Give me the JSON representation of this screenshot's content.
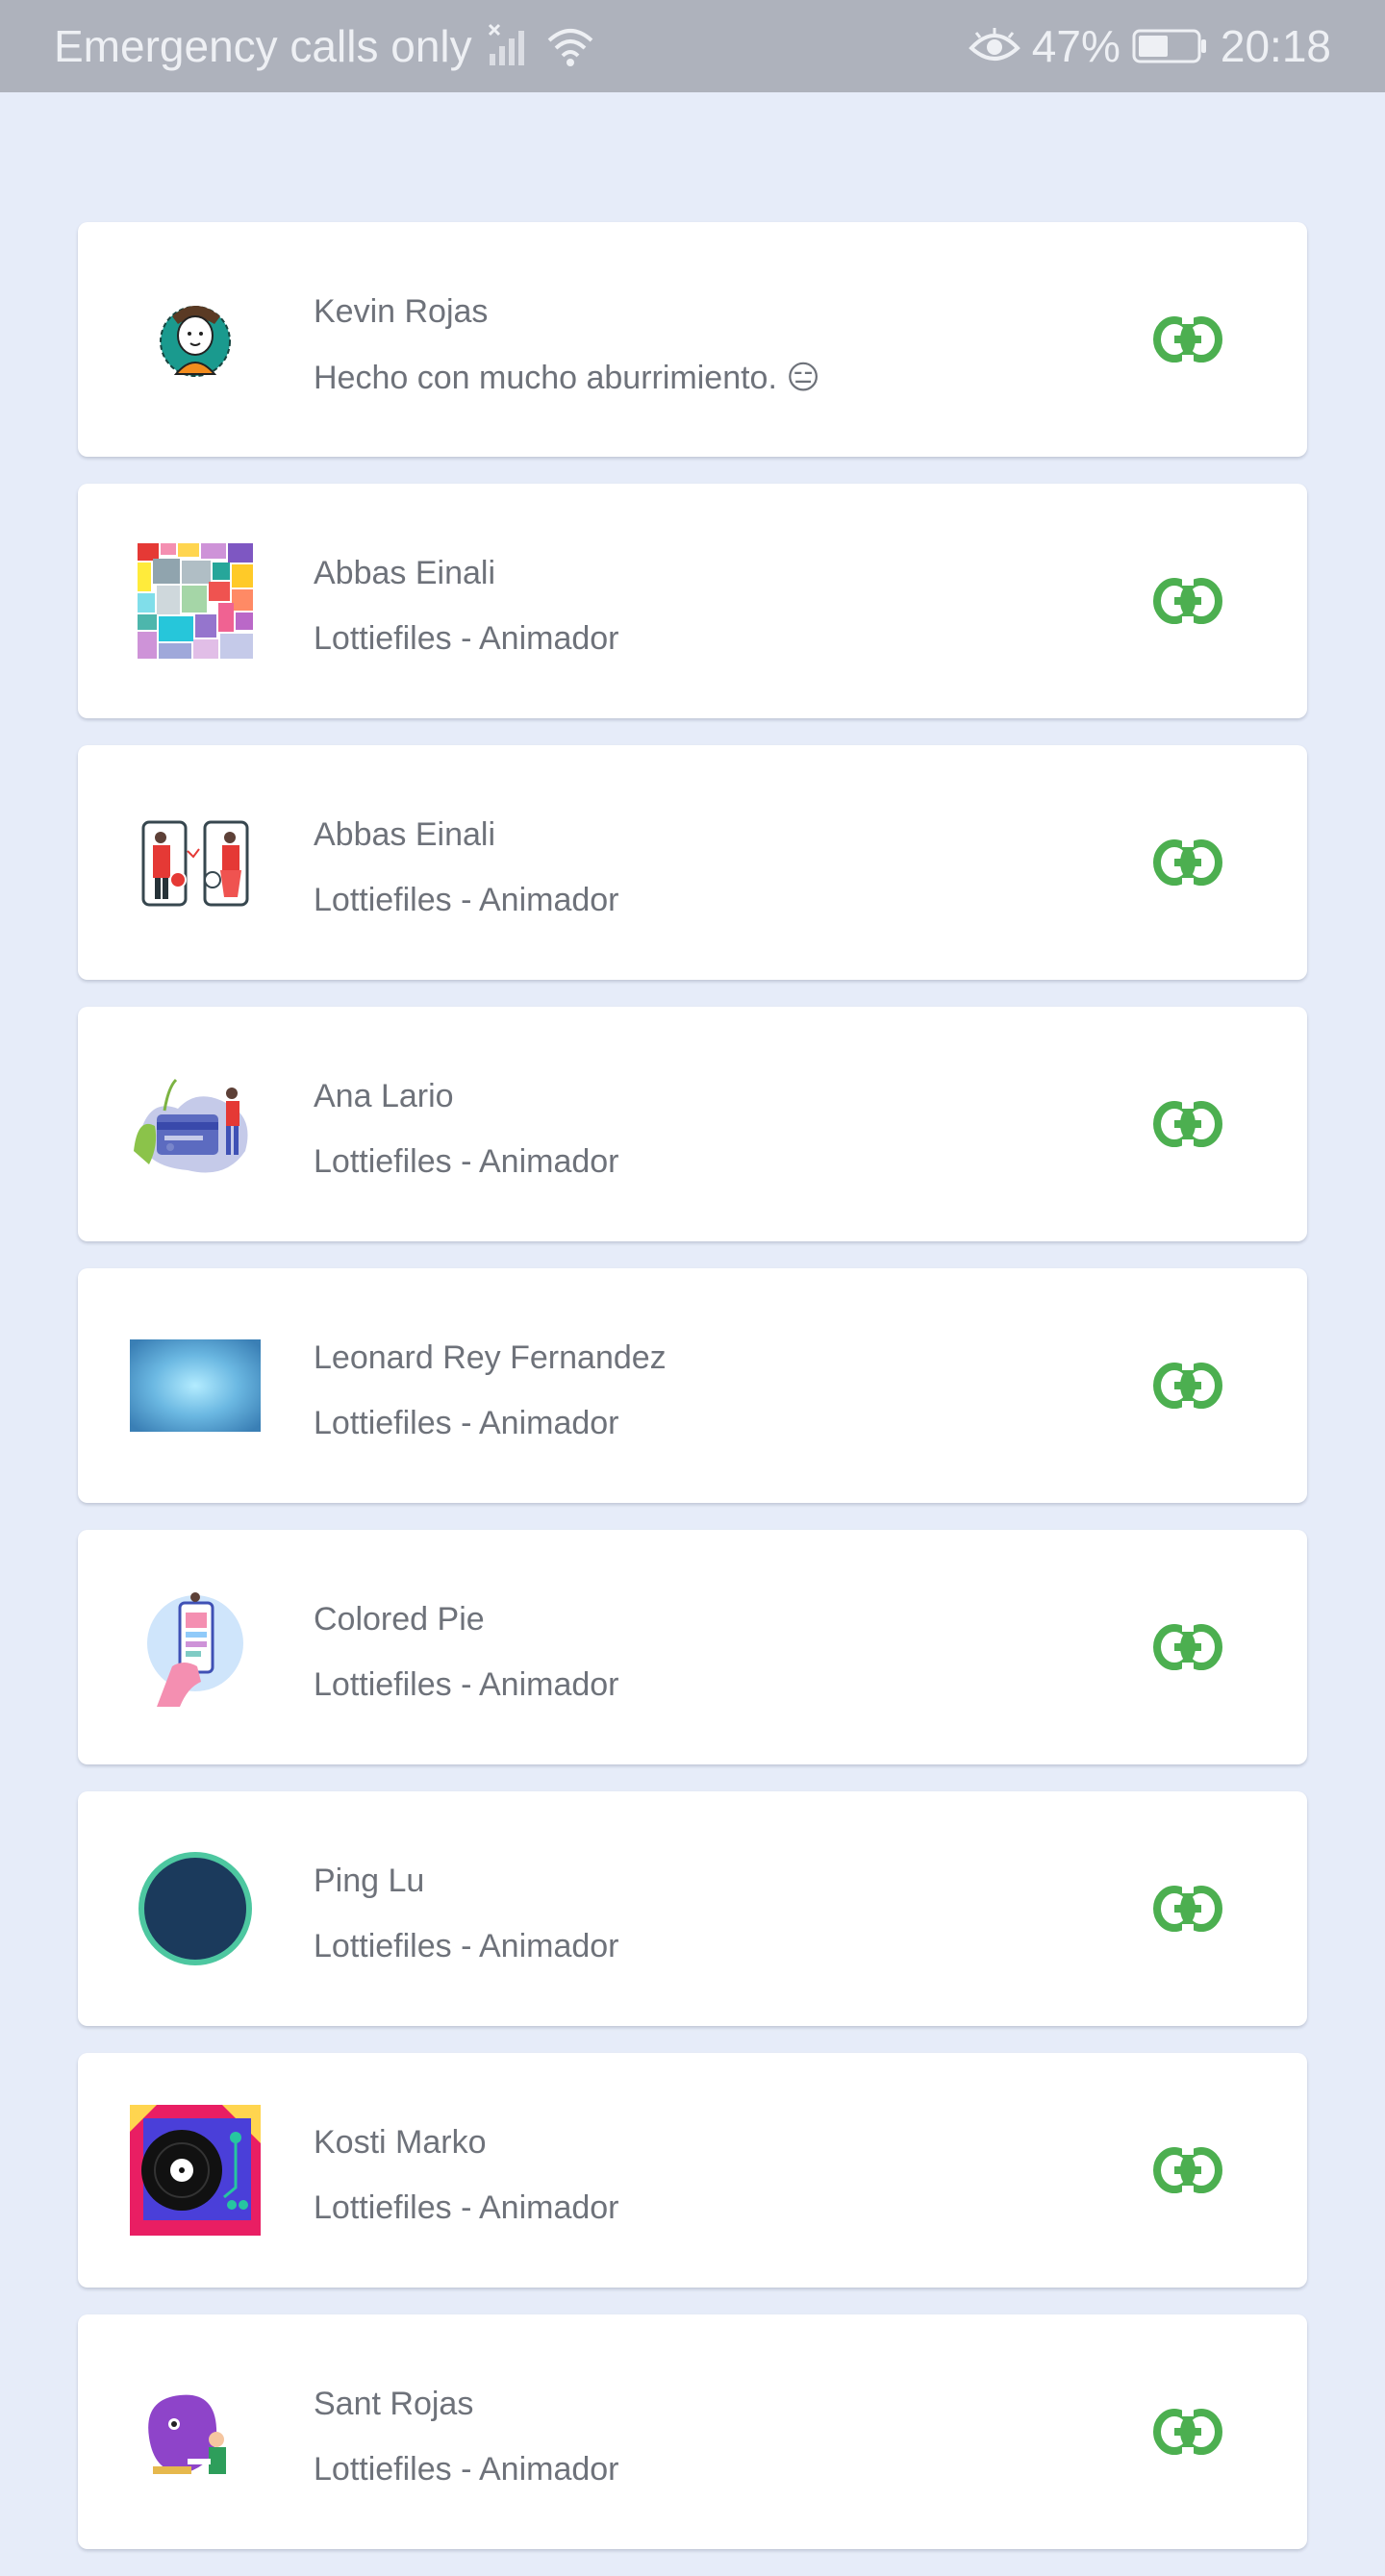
{
  "status_bar": {
    "carrier": "Emergency calls only",
    "battery": "47%",
    "time": "20:18"
  },
  "colors": {
    "link_icon": "#4caf50",
    "background": "#e6ecf9",
    "status_bar": "#aeb2bc"
  },
  "credits": [
    {
      "name": "Kevin Rojas",
      "subtitle": "Hecho con mucho aburrimiento. 😑",
      "thumbnail": "cartoon-avatar"
    },
    {
      "name": "Abbas Einali",
      "subtitle": "Lottiefiles - Animador",
      "thumbnail": "color-blocks-animation"
    },
    {
      "name": "Abbas Einali",
      "subtitle": "Lottiefiles - Animador",
      "thumbnail": "phones-crypto-animation"
    },
    {
      "name": "Ana Lario",
      "subtitle": "Lottiefiles - Animador",
      "thumbnail": "credit-card-animation"
    },
    {
      "name": "Leonard Rey Fernandez",
      "subtitle": "Lottiefiles - Animador",
      "thumbnail": "blue-gradient-animation"
    },
    {
      "name": "Colored Pie",
      "subtitle": "Lottiefiles - Animador",
      "thumbnail": "hand-phone-animation"
    },
    {
      "name": "Ping Lu",
      "subtitle": "Lottiefiles - Animador",
      "thumbnail": "dark-circle-animation"
    },
    {
      "name": "Kosti Marko",
      "subtitle": "Lottiefiles - Animador",
      "thumbnail": "turntable-animation"
    },
    {
      "name": "Sant Rojas",
      "subtitle": "Lottiefiles - Animador",
      "thumbnail": "purple-character-animation"
    }
  ]
}
